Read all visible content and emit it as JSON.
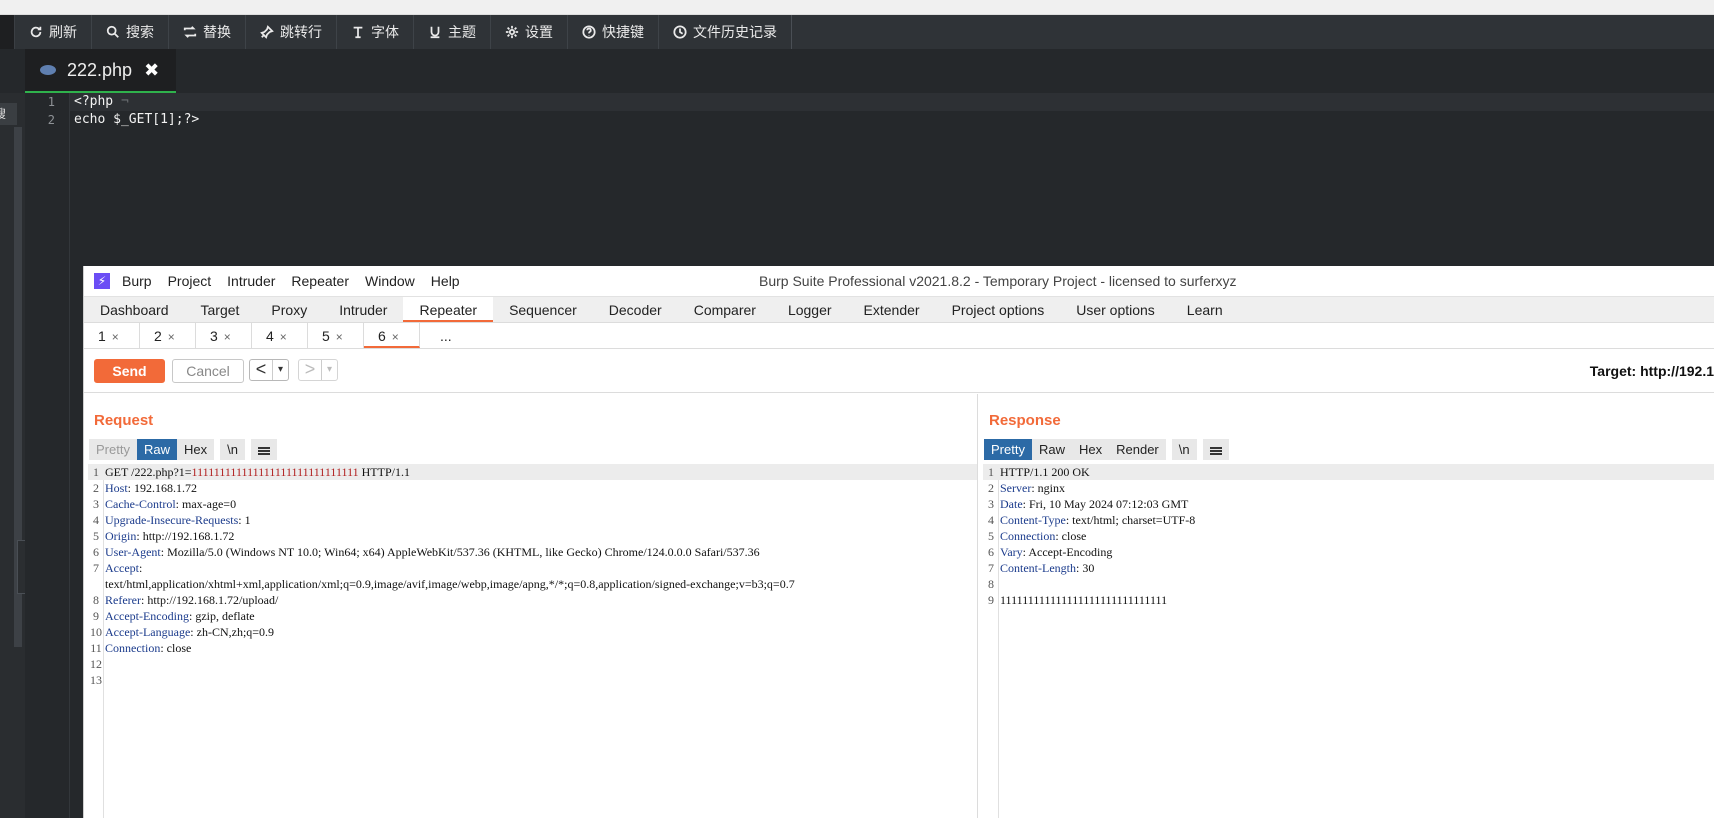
{
  "editor": {
    "toolbar": [
      {
        "label": "刷新",
        "icon": "refresh-icon"
      },
      {
        "label": "搜索",
        "icon": "search-icon"
      },
      {
        "label": "替换",
        "icon": "replace-icon"
      },
      {
        "label": "跳转行",
        "icon": "pin-icon"
      },
      {
        "label": "字体",
        "icon": "text-icon"
      },
      {
        "label": "主题",
        "icon": "underline-icon"
      },
      {
        "label": "设置",
        "icon": "gear-icon"
      },
      {
        "label": "快捷键",
        "icon": "question-icon"
      },
      {
        "label": "文件历史记录",
        "icon": "clock-icon"
      }
    ],
    "tab_name": "222.php",
    "tab_close": "✖",
    "side_search_label": "搜索",
    "collapse_arrow": "‹",
    "line_numbers": [
      "1",
      "2"
    ],
    "lines": [
      {
        "code": "<?php",
        "ws": " ¬"
      },
      {
        "code": "echo $_GET[1];?>",
        "ws": ""
      }
    ]
  },
  "burp": {
    "logo": "⚡",
    "menu": [
      "Burp",
      "Project",
      "Intruder",
      "Repeater",
      "Window",
      "Help"
    ],
    "title": "Burp Suite Professional v2021.8.2 - Temporary Project - licensed to surferxyz",
    "main_tabs": [
      "Dashboard",
      "Target",
      "Proxy",
      "Intruder",
      "Repeater",
      "Sequencer",
      "Decoder",
      "Comparer",
      "Logger",
      "Extender",
      "Project options",
      "User options",
      "Learn"
    ],
    "active_main_tab": "Repeater",
    "sub_tabs": [
      "1",
      "2",
      "3",
      "4",
      "5",
      "6"
    ],
    "sub_tab_close": "×",
    "active_sub_tab": "6",
    "sub_tab_more": "...",
    "send_label": "Send",
    "cancel_label": "Cancel",
    "back_arrow": "<",
    "forward_arrow": ">",
    "dropdown_caret": "▾",
    "target_label": "Target: http://192.1",
    "accent_color": "#f26a39",
    "request": {
      "title": "Request",
      "view_tabs": [
        "Pretty",
        "Raw",
        "Hex",
        "\\n"
      ],
      "active_view": "Raw",
      "lines": [
        {
          "n": "1",
          "name": "GET /222.php?1=",
          "value": "111111111111111111111111111111",
          "tail": " HTTP/1.1"
        },
        {
          "n": "2",
          "name": "Host",
          "value": " 192.168.1.72"
        },
        {
          "n": "3",
          "name": "Cache-Control",
          "value": " max-age=0"
        },
        {
          "n": "4",
          "name": "Upgrade-Insecure-Requests",
          "value": " 1"
        },
        {
          "n": "5",
          "name": "Origin",
          "value": " http://192.168.1.72"
        },
        {
          "n": "6",
          "name": "User-Agent",
          "value": " Mozilla/5.0 (Windows NT 10.0; Win64; x64) AppleWebKit/537.36 (KHTML, like Gecko) Chrome/124.0.0.0 Safari/537.36"
        },
        {
          "n": "7",
          "name": "Accept",
          "value": ""
        },
        {
          "n": "",
          "name": "",
          "value": "text/html,application/xhtml+xml,application/xml;q=0.9,image/avif,image/webp,image/apng,*/*;q=0.8,application/signed-exchange;v=b3;q=0.7"
        },
        {
          "n": "8",
          "name": "Referer",
          "value": " http://192.168.1.72/upload/"
        },
        {
          "n": "9",
          "name": "Accept-Encoding",
          "value": " gzip, deflate"
        },
        {
          "n": "10",
          "name": "Accept-Language",
          "value": " zh-CN,zh;q=0.9"
        },
        {
          "n": "11",
          "name": "Connection",
          "value": " close"
        },
        {
          "n": "12",
          "name": "",
          "value": ""
        },
        {
          "n": "13",
          "name": "",
          "value": ""
        }
      ]
    },
    "response": {
      "title": "Response",
      "view_tabs": [
        "Pretty",
        "Raw",
        "Hex",
        "Render",
        "\\n"
      ],
      "active_view": "Pretty",
      "lines": [
        {
          "n": "1",
          "name": "",
          "value": "HTTP/1.1 200 OK"
        },
        {
          "n": "2",
          "name": "Server",
          "value": " nginx"
        },
        {
          "n": "3",
          "name": "Date",
          "value": " Fri, 10 May 2024 07:12:03 GMT"
        },
        {
          "n": "4",
          "name": "Content-Type",
          "value": " text/html; charset=UTF-8"
        },
        {
          "n": "5",
          "name": "Connection",
          "value": " close"
        },
        {
          "n": "6",
          "name": "Vary",
          "value": " Accept-Encoding"
        },
        {
          "n": "7",
          "name": "Content-Length",
          "value": " 30"
        },
        {
          "n": "8",
          "name": "",
          "value": ""
        },
        {
          "n": "9",
          "name": "",
          "value": "111111111111111111111111111111"
        }
      ]
    }
  }
}
